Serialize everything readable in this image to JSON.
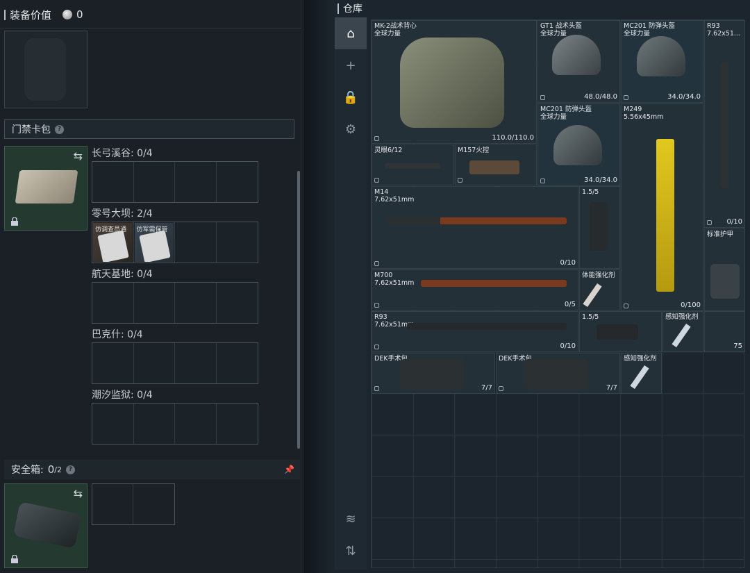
{
  "left": {
    "equip_value_label": "装备价值",
    "equip_value": "0",
    "keycard_title": "门禁卡包",
    "maps": [
      {
        "label": "长弓溪谷: 0/4"
      },
      {
        "label": "零号大坝: 2/4",
        "cards": [
          "仿调查员通",
          "仿军需保管"
        ]
      },
      {
        "label": "航天基地: 0/4"
      },
      {
        "label": "巴克什: 0/4"
      },
      {
        "label": "潮汐监狱: 0/4"
      }
    ],
    "safe_title": "安全箱:",
    "safe_count": "0",
    "safe_max": "/2"
  },
  "right": {
    "title": "仓库",
    "items": [
      {
        "id": "vest",
        "name": "MK-2战术背心\n全球力量",
        "value": "110.0/110.0"
      },
      {
        "id": "gt1",
        "name": "GT1 战术头盔\n全球力量",
        "value": "48.0/48.0"
      },
      {
        "id": "mc201a",
        "name": "MC201 防弹头盔\n全球力量",
        "value": "34.0/34.0"
      },
      {
        "id": "r93a",
        "name": "R93\n7.62x51...",
        "value": "0/10"
      },
      {
        "id": "mc201b",
        "name": "MC201 防弹头盔\n全球力量",
        "value": "34.0/34.0"
      },
      {
        "id": "m249",
        "name": "M249\n5.56x45mm",
        "value": "0/100"
      },
      {
        "id": "scope",
        "name": "灵眼6/12",
        "value": ""
      },
      {
        "id": "m157",
        "name": "M157火控",
        "value": ""
      },
      {
        "id": "m14",
        "name": "M14\n7.62x51mm",
        "value": "0/10"
      },
      {
        "id": "nv1",
        "name": "1.5/5",
        "value": ""
      },
      {
        "id": "armor",
        "name": "标准护甲",
        "value": ""
      },
      {
        "id": "m700",
        "name": "M700\n7.62x51mm",
        "value": "0/5"
      },
      {
        "id": "stim1",
        "name": "体能强化剂",
        "value": ""
      },
      {
        "id": "r93b",
        "name": "R93\n7.62x51mm",
        "value": "0/10"
      },
      {
        "id": "nv2",
        "name": "1.5/5",
        "value": ""
      },
      {
        "id": "stim2",
        "name": "感知强化剂",
        "value": ""
      },
      {
        "id": "ammo",
        "name": "",
        "value": "75"
      },
      {
        "id": "dek1",
        "name": "DEK手术包",
        "value": "7/7"
      },
      {
        "id": "dek2",
        "name": "DEK手术包",
        "value": "7/7"
      },
      {
        "id": "stim3",
        "name": "感知强化剂",
        "value": ""
      }
    ]
  }
}
